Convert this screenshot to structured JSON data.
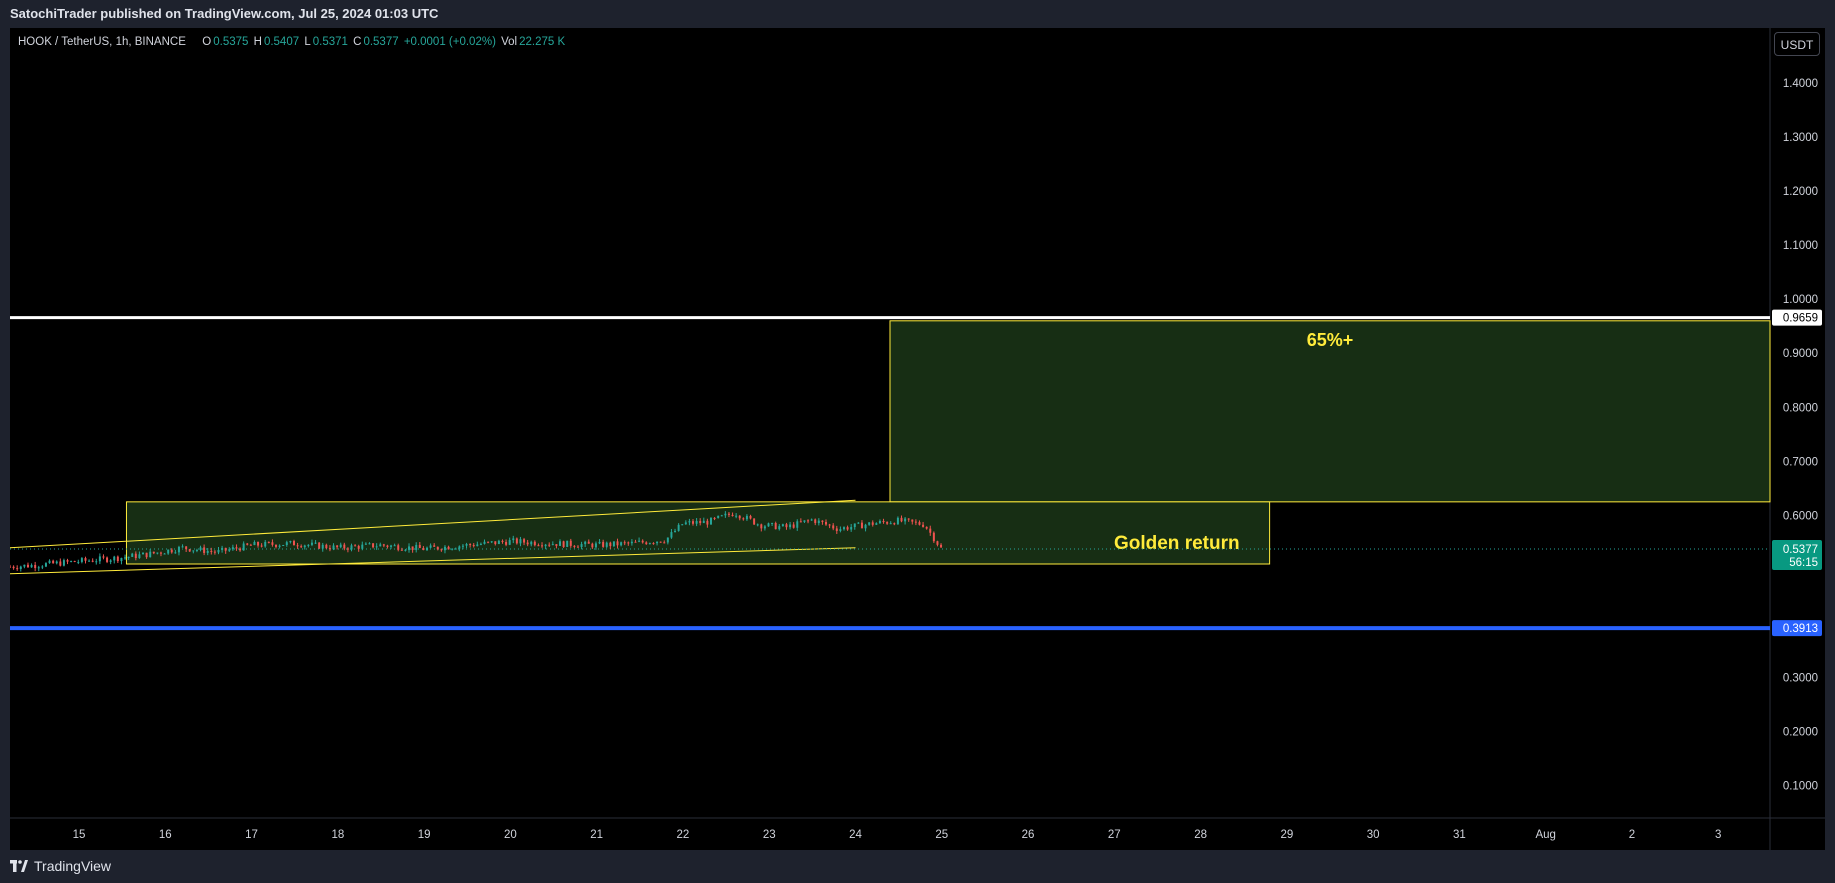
{
  "header": {
    "published_text": "SatochiTrader published on TradingView.com, Jul 25, 2024 01:03 UTC"
  },
  "legend": {
    "symbol": "HOOK / TetherUS, 1h, BINANCE",
    "open_label": "O",
    "open": "0.5375",
    "high_label": "H",
    "high": "0.5407",
    "low_label": "L",
    "low": "0.5371",
    "close_label": "C",
    "close": "0.5377",
    "change": "+0.0001 (+0.02%)",
    "vol_label": "Vol",
    "vol": "22.275 K"
  },
  "currency_button": "USDT",
  "footer": {
    "brand": "TradingView"
  },
  "colors": {
    "background": "#000000",
    "frame": "#1e222d",
    "up": "#26a69a",
    "down": "#ef5350",
    "zone": "#ffeb3b",
    "zone_fill": "#1b3617",
    "resistance": "#ffffff",
    "support": "#2962ff",
    "price_tag": "#089981"
  },
  "chart_data": {
    "type": "candlestick",
    "symbol": "HOOK / TetherUS",
    "interval": "1h",
    "exchange": "BINANCE",
    "x_ticks": [
      "15",
      "16",
      "17",
      "18",
      "19",
      "20",
      "21",
      "22",
      "23",
      "24",
      "25",
      "26",
      "27",
      "28",
      "29",
      "30",
      "31",
      "Aug",
      "2",
      "3"
    ],
    "y_ticks": [
      "1.4000",
      "1.3000",
      "1.2000",
      "1.1000",
      "1.0000",
      "0.9000",
      "0.8000",
      "0.7000",
      "0.6000",
      "0.3000",
      "0.2000",
      "0.1000"
    ],
    "ylim": [
      0.04,
      1.45
    ],
    "xlim": [
      14.2,
      34.6
    ],
    "grid": false,
    "last_price": "0.5377",
    "countdown": "56:15",
    "price_path": [
      [
        14.2,
        0.505
      ],
      [
        14.5,
        0.508
      ],
      [
        15.0,
        0.515
      ],
      [
        15.5,
        0.522
      ],
      [
        15.8,
        0.528
      ],
      [
        16.2,
        0.54
      ],
      [
        16.6,
        0.532
      ],
      [
        17.0,
        0.545
      ],
      [
        17.5,
        0.548
      ],
      [
        18.0,
        0.54
      ],
      [
        18.5,
        0.545
      ],
      [
        19.0,
        0.538
      ],
      [
        19.5,
        0.545
      ],
      [
        20.0,
        0.552
      ],
      [
        20.5,
        0.548
      ],
      [
        21.0,
        0.545
      ],
      [
        21.4,
        0.548
      ],
      [
        21.8,
        0.555
      ],
      [
        22.0,
        0.585
      ],
      [
        22.3,
        0.588
      ],
      [
        22.6,
        0.605
      ],
      [
        22.9,
        0.582
      ],
      [
        23.2,
        0.578
      ],
      [
        23.5,
        0.592
      ],
      [
        23.8,
        0.575
      ],
      [
        24.2,
        0.585
      ],
      [
        24.5,
        0.59
      ],
      [
        24.8,
        0.583
      ],
      [
        25.0,
        0.537
      ]
    ],
    "horizontal_lines": [
      {
        "price": 0.9659,
        "label": "0.9659"
      },
      {
        "price": 0.3913,
        "label": "0.3913"
      }
    ],
    "zones": [
      {
        "text": "65%+",
        "x_start": 24.4,
        "x_end": 34.6,
        "price_top": 0.96,
        "price_bottom": 0.625
      },
      {
        "text": "Golden return",
        "x_start": 15.55,
        "x_end": 28.8,
        "price_top": 0.625,
        "price_bottom": 0.51
      }
    ],
    "channel": {
      "upper": [
        [
          14.2,
          0.54
        ],
        [
          24.0,
          0.628
        ]
      ],
      "lower": [
        [
          14.2,
          0.492
        ],
        [
          24.0,
          0.54
        ]
      ]
    }
  }
}
